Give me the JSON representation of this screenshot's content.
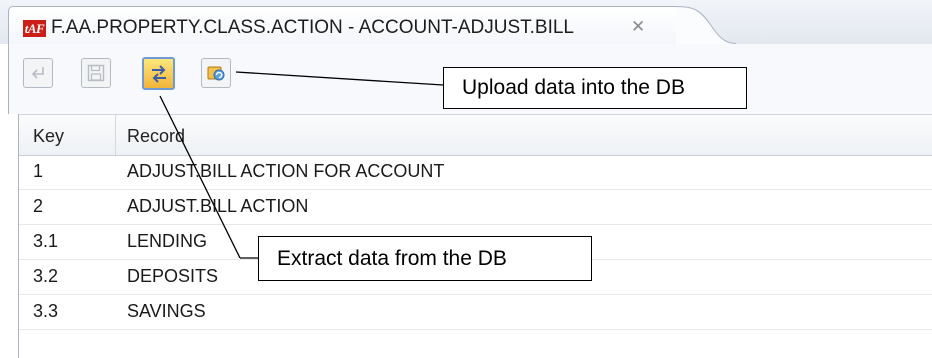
{
  "tab": {
    "icon_text": "tAF",
    "title": "F.AA.PROPERTY.CLASS.ACTION - ACCOUNT-ADJUST.BILL",
    "close_glyph": "✕"
  },
  "toolbar": {
    "buttons": [
      {
        "name": "undo-button",
        "icon": "undo-arrow-icon",
        "enabled": false
      },
      {
        "name": "save-button",
        "icon": "floppy-disk-icon",
        "enabled": false
      },
      {
        "name": "extract-button",
        "icon": "swap-arrows-icon",
        "enabled": true,
        "highlighted": true
      },
      {
        "name": "upload-button",
        "icon": "refresh-database-icon",
        "enabled": true
      }
    ]
  },
  "table": {
    "headers": {
      "key": "Key",
      "record": "Record"
    },
    "rows": [
      {
        "key": "1",
        "record": "ADJUST.BILL ACTION FOR ACCOUNT"
      },
      {
        "key": "2",
        "record": "ADJUST.BILL ACTION"
      },
      {
        "key": "3.1",
        "record": "LENDING"
      },
      {
        "key": "3.2",
        "record": "DEPOSITS"
      },
      {
        "key": "3.3",
        "record": "SAVINGS"
      }
    ]
  },
  "callouts": {
    "upload": "Upload data into the DB",
    "extract": "Extract data from the DB"
  },
  "colors": {
    "tab_icon_bg": "#cc1d16",
    "highlight_border": "#6e9bd6",
    "highlight_fill": "#f2b43a"
  }
}
